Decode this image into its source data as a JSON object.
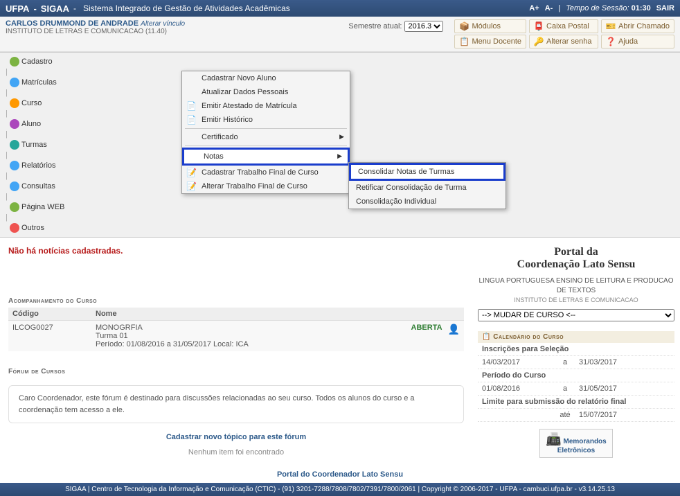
{
  "topbar": {
    "app": "UFPA",
    "system": "SIGAA",
    "subtitle": "Sistema Integrado de Gestão de Atividades Acadêmicas",
    "aplus": "A+",
    "aminus": "A-",
    "session_label": "Tempo de Sessão:",
    "session_time": "01:30",
    "exit": "SAIR"
  },
  "userbar": {
    "name": "CARLOS DRUMMOND DE ANDRADE",
    "changelink": "Alterar vínculo",
    "dept": "INSTITUTO DE LETRAS E COMUNICACAO (11.40)",
    "semester_label": "Semestre atual:",
    "semester_value": "2016.3"
  },
  "quicklinks": [
    {
      "icon": "📦",
      "label": "Módulos"
    },
    {
      "icon": "📮",
      "label": "Caixa Postal"
    },
    {
      "icon": "🎫",
      "label": "Abrir Chamado"
    },
    {
      "icon": "📋",
      "label": "Menu Docente"
    },
    {
      "icon": "🔑",
      "label": "Alterar senha"
    },
    {
      "icon": "❓",
      "label": "Ajuda"
    }
  ],
  "mainmenu": [
    {
      "icon": "ic-green",
      "label": "Cadastro"
    },
    {
      "icon": "ic-blue",
      "label": "Matrículas"
    },
    {
      "icon": "ic-orange",
      "label": "Curso"
    },
    {
      "icon": "ic-purple",
      "label": "Aluno"
    },
    {
      "icon": "ic-teal",
      "label": "Turmas"
    },
    {
      "icon": "ic-blue",
      "label": "Relatórios"
    },
    {
      "icon": "ic-blue",
      "label": "Consultas"
    },
    {
      "icon": "ic-green",
      "label": "Página WEB"
    },
    {
      "icon": "ic-red",
      "label": "Outros"
    }
  ],
  "dropdown": {
    "items": [
      {
        "label": "Cadastrar Novo Aluno",
        "icon": ""
      },
      {
        "label": "Atualizar Dados Pessoais",
        "icon": ""
      },
      {
        "label": "Emitir Atestado de Matrícula",
        "icon": "📄"
      },
      {
        "label": "Emitir Histórico",
        "icon": "📄"
      },
      {
        "label": "Certificado",
        "icon": "",
        "arrow": true,
        "divider_before": true
      },
      {
        "label": "Notas",
        "icon": "",
        "arrow": true,
        "highlight": true,
        "divider_before": true
      },
      {
        "label": "Cadastrar Trabalho Final de Curso",
        "icon": "📝"
      },
      {
        "label": "Alterar Trabalho Final de Curso",
        "icon": "📝"
      }
    ]
  },
  "submenu": {
    "items": [
      {
        "label": "Consolidar Notas de Turmas",
        "highlight": true
      },
      {
        "label": "Retificar Consolidação de Turma"
      },
      {
        "label": "Consolidação Individual"
      }
    ]
  },
  "notice": "Não há notícias cadastradas.",
  "acomp": {
    "title": "Acompanhamento do Curso",
    "col1": "Código",
    "col2": "Nome",
    "code": "ILCOG0027",
    "name1": "MONOGRFIA",
    "name2": "Turma 01",
    "period": "Período: 01/08/2016 a 31/05/2017 Local: ICA",
    "status": "ABERTA"
  },
  "forum": {
    "title": "Fórum de Cursos",
    "text": "Caro Coordenador, este fórum é destinado para discussões relacionadas ao seu curso. Todos os alunos do curso e a coordenação tem acesso a ele.",
    "link": "Cadastrar novo tópico para este fórum",
    "empty": "Nenhum item foi encontrado"
  },
  "portal": {
    "l1": "Portal da",
    "l2": "Coordenação Lato Sensu",
    "course1": "LINGUA PORTUGUESA ENSINO DE LEITURA E PRODUCAO DE TEXTOS",
    "course2": "INSTITUTO DE LETRAS E COMUNICACAO",
    "select": "--> MUDAR DE CURSO <--"
  },
  "calendar": {
    "title": "Calendário do Curso",
    "r1_label": "Inscrições para Seleção",
    "r1_d1": "14/03/2017",
    "r1_mid": "a",
    "r1_d2": "31/03/2017",
    "r2_label": "Período do Curso",
    "r2_d1": "01/08/2016",
    "r2_mid": "a",
    "r2_d2": "31/05/2017",
    "r3_label": "Limite para submissão do relatório final",
    "r3_mid": "até",
    "r3_d2": "15/07/2017"
  },
  "memo": {
    "l1": "Memorandos",
    "l2": "Eletrônicos"
  },
  "bottomlink": "Portal do Coordenador Lato Sensu",
  "footer": "SIGAA | Centro de Tecnologia da Informação e Comunicação (CTIC) - (91) 3201-7288/7808/7802/7391/7800/2061 | Copyright © 2006-2017 - UFPA - cambuci.ufpa.br - v3.14.25.13"
}
